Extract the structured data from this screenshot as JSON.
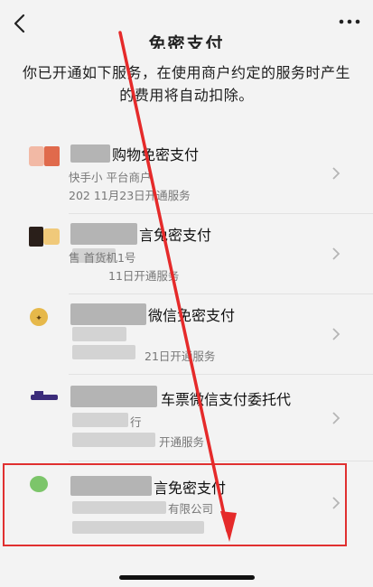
{
  "header": {
    "back_icon": "chevron-left-icon",
    "more_icon": "more-dots-icon",
    "title": "免密支付"
  },
  "description": "你已开通如下服务，在使用商户约定的服务时产生的费用将自动扣除。",
  "services": [
    {
      "name": "购物免密支付",
      "line2": "快手小 平台商户",
      "line3": "202 11月23日开通服务"
    },
    {
      "name": "言免密支付",
      "line2": "售 首货机1号",
      "line3": "11日开通服务"
    },
    {
      "name": "微信免密支付",
      "line2": "",
      "line3": "21日开通服务"
    },
    {
      "name": "车票微信支付委托代",
      "line2": "行",
      "line3": "开通服务"
    },
    {
      "name": "言免密支付",
      "line2": "有限公司",
      "line3": ""
    }
  ],
  "colors": {
    "highlight": "#e03030",
    "arrow": "#e52a2a",
    "chevron": "#b5b5b5"
  }
}
